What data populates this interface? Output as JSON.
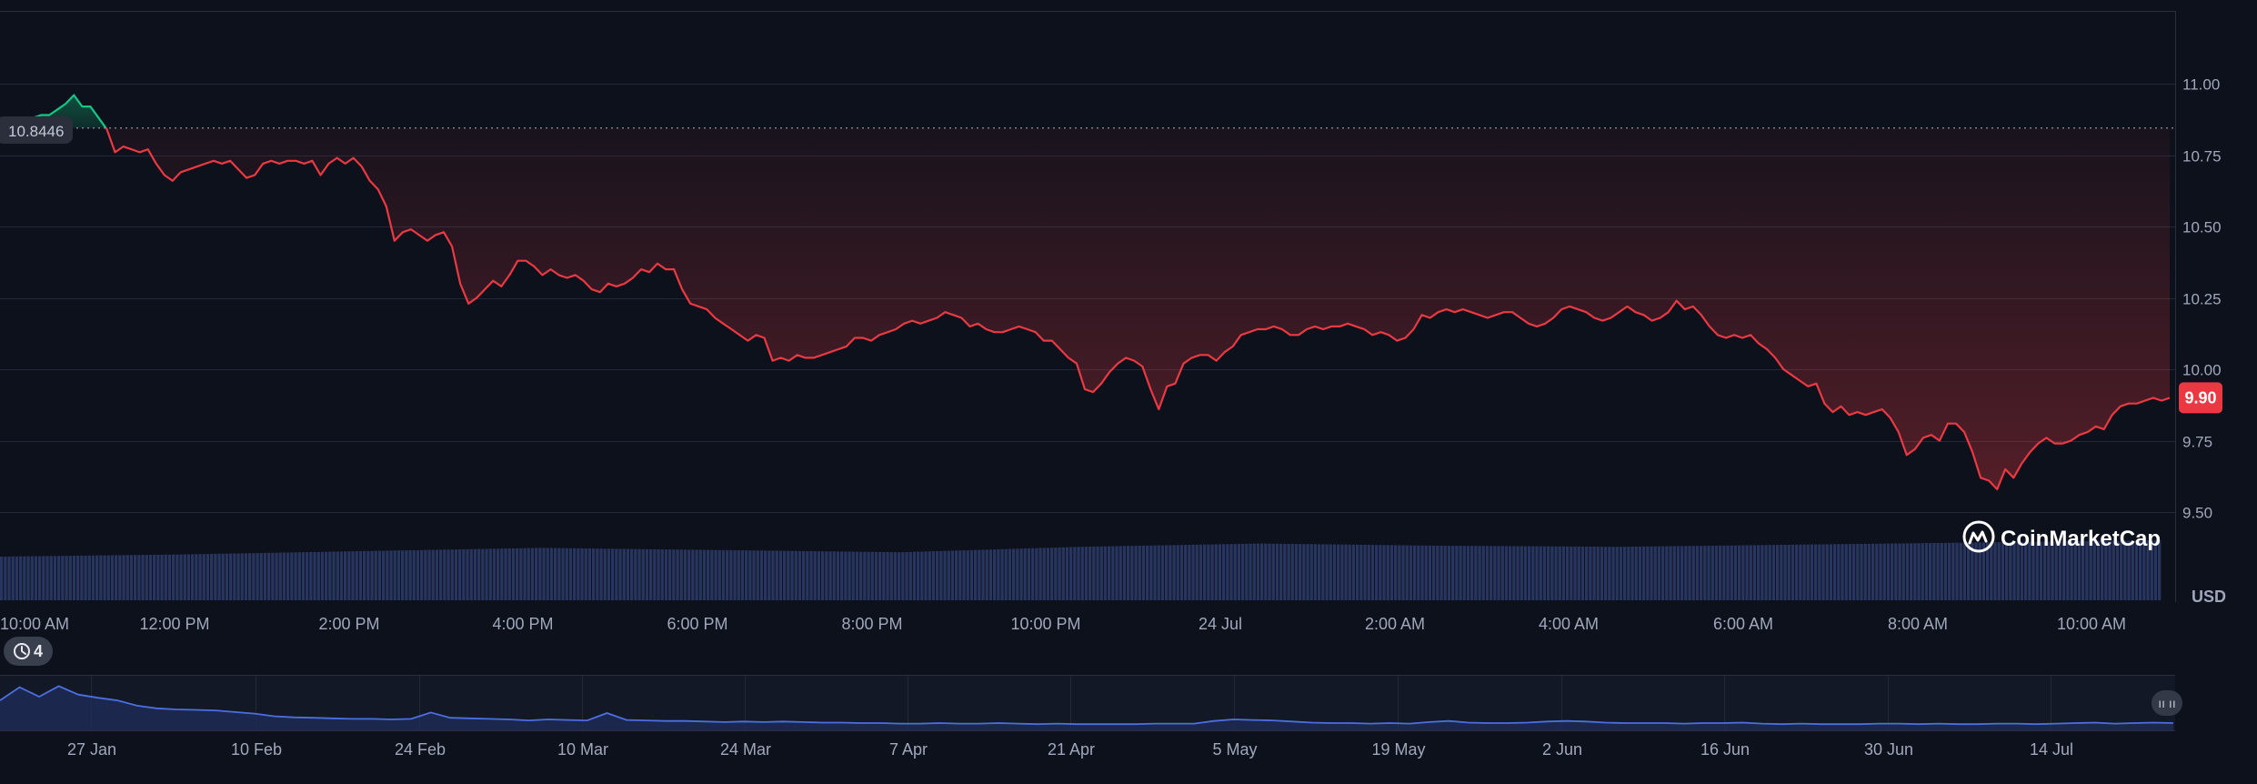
{
  "chart_data": {
    "type": "line",
    "currency_label": "USD",
    "reference_price": 10.8446,
    "reference_label": "10.8446",
    "last_price_label": "9.90",
    "y_ticks": [
      11.0,
      10.75,
      10.5,
      10.25,
      10.0,
      9.75,
      9.5
    ],
    "y_tick_labels": [
      "11.00",
      "10.75",
      "10.50",
      "10.25",
      "10.00",
      "9.75",
      "9.50"
    ],
    "ylim": [
      9.5,
      11.25
    ],
    "x_tick_labels": [
      "10:00 AM",
      "12:00 PM",
      "2:00 PM",
      "4:00 PM",
      "6:00 PM",
      "8:00 PM",
      "10:00 PM",
      "24 Jul",
      "2:00 AM",
      "4:00 AM",
      "6:00 AM",
      "8:00 AM",
      "10:00 AM"
    ],
    "series": [
      {
        "values": [
          10.86,
          10.86,
          10.87,
          10.88,
          10.88,
          10.89,
          10.89,
          10.91,
          10.93,
          10.96,
          10.92,
          10.92,
          10.88,
          10.84,
          10.76,
          10.78,
          10.77,
          10.76,
          10.77,
          10.72,
          10.68,
          10.66,
          10.69,
          10.7,
          10.71,
          10.72,
          10.73,
          10.72,
          10.73,
          10.7,
          10.67,
          10.68,
          10.72,
          10.73,
          10.72,
          10.73,
          10.73,
          10.72,
          10.73,
          10.68,
          10.72,
          10.74,
          10.72,
          10.74,
          10.71,
          10.66,
          10.63,
          10.57,
          10.45,
          10.48,
          10.49,
          10.47,
          10.45,
          10.47,
          10.48,
          10.43,
          10.3,
          10.23,
          10.25,
          10.28,
          10.31,
          10.29,
          10.33,
          10.38,
          10.38,
          10.36,
          10.33,
          10.35,
          10.33,
          10.32,
          10.33,
          10.31,
          10.28,
          10.27,
          10.3,
          10.29,
          10.3,
          10.32,
          10.35,
          10.34,
          10.37,
          10.35,
          10.35,
          10.28,
          10.23,
          10.22,
          10.21,
          10.18,
          10.16,
          10.14,
          10.12,
          10.1,
          10.12,
          10.11,
          10.03,
          10.04,
          10.03,
          10.05,
          10.04,
          10.04,
          10.05,
          10.06,
          10.07,
          10.08,
          10.11,
          10.11,
          10.1,
          10.12,
          10.13,
          10.14,
          10.16,
          10.17,
          10.16,
          10.17,
          10.18,
          10.2,
          10.19,
          10.18,
          10.15,
          10.16,
          10.14,
          10.13,
          10.13,
          10.14,
          10.15,
          10.14,
          10.13,
          10.1,
          10.1,
          10.07,
          10.04,
          10.02,
          9.93,
          9.92,
          9.95,
          9.99,
          10.02,
          10.04,
          10.03,
          10.01,
          9.93,
          9.86,
          9.94,
          9.95,
          10.02,
          10.04,
          10.05,
          10.05,
          10.03,
          10.06,
          10.08,
          10.12,
          10.13,
          10.14,
          10.14,
          10.15,
          10.14,
          10.12,
          10.12,
          10.14,
          10.15,
          10.14,
          10.15,
          10.15,
          10.16,
          10.15,
          10.14,
          10.12,
          10.13,
          10.12,
          10.1,
          10.11,
          10.14,
          10.19,
          10.18,
          10.2,
          10.21,
          10.2,
          10.21,
          10.2,
          10.19,
          10.18,
          10.19,
          10.2,
          10.2,
          10.18,
          10.16,
          10.15,
          10.16,
          10.18,
          10.21,
          10.22,
          10.21,
          10.2,
          10.18,
          10.17,
          10.18,
          10.2,
          10.22,
          10.2,
          10.19,
          10.17,
          10.18,
          10.2,
          10.24,
          10.21,
          10.22,
          10.19,
          10.15,
          10.12,
          10.11,
          10.12,
          10.11,
          10.12,
          10.09,
          10.07,
          10.04,
          10.0,
          9.98,
          9.96,
          9.94,
          9.95,
          9.88,
          9.85,
          9.87,
          9.84,
          9.85,
          9.84,
          9.85,
          9.86,
          9.83,
          9.78,
          9.7,
          9.72,
          9.76,
          9.77,
          9.75,
          9.81,
          9.81,
          9.78,
          9.71,
          9.62,
          9.61,
          9.58,
          9.65,
          9.62,
          9.67,
          9.71,
          9.74,
          9.76,
          9.74,
          9.74,
          9.75,
          9.77,
          9.78,
          9.8,
          9.79,
          9.84,
          9.87,
          9.88,
          9.88,
          9.89,
          9.9,
          9.89,
          9.9
        ]
      }
    ],
    "volume": {
      "relative_levels": [
        0.4,
        0.42,
        0.45,
        0.48,
        0.46,
        0.44,
        0.49,
        0.52,
        0.5,
        0.49,
        0.51,
        0.53,
        0.55
      ]
    },
    "navigator": {
      "x_tick_labels": [
        "27 Jan",
        "10 Feb",
        "24 Feb",
        "10 Mar",
        "24 Mar",
        "7 Apr",
        "21 Apr",
        "5 May",
        "19 May",
        "2 Jun",
        "16 Jun",
        "30 Jun",
        "14 Jul"
      ],
      "values": [
        0.55,
        0.8,
        0.62,
        0.82,
        0.66,
        0.6,
        0.55,
        0.45,
        0.4,
        0.38,
        0.37,
        0.36,
        0.33,
        0.3,
        0.25,
        0.23,
        0.22,
        0.21,
        0.2,
        0.2,
        0.19,
        0.2,
        0.32,
        0.22,
        0.21,
        0.2,
        0.19,
        0.17,
        0.19,
        0.18,
        0.17,
        0.31,
        0.18,
        0.17,
        0.16,
        0.16,
        0.15,
        0.14,
        0.15,
        0.14,
        0.15,
        0.14,
        0.13,
        0.13,
        0.12,
        0.12,
        0.11,
        0.11,
        0.12,
        0.11,
        0.11,
        0.12,
        0.11,
        0.1,
        0.11,
        0.1,
        0.1,
        0.1,
        0.1,
        0.11,
        0.11,
        0.11,
        0.16,
        0.19,
        0.18,
        0.17,
        0.15,
        0.13,
        0.12,
        0.12,
        0.11,
        0.12,
        0.11,
        0.14,
        0.16,
        0.13,
        0.12,
        0.12,
        0.13,
        0.15,
        0.16,
        0.15,
        0.13,
        0.12,
        0.12,
        0.12,
        0.11,
        0.12,
        0.12,
        0.13,
        0.11,
        0.1,
        0.11,
        0.1,
        0.1,
        0.1,
        0.11,
        0.11,
        0.1,
        0.11,
        0.1,
        0.1,
        0.11,
        0.11,
        0.1,
        0.11,
        0.12,
        0.13,
        0.11,
        0.12,
        0.13,
        0.12
      ]
    }
  },
  "ui": {
    "history_count": "4",
    "watermark": "CoinMarketCap",
    "colors": {
      "down": "#ea3943",
      "up": "#16c784",
      "bg": "#0d111b",
      "volume": "#28365f",
      "navigator_line": "#4c6fe0"
    }
  }
}
